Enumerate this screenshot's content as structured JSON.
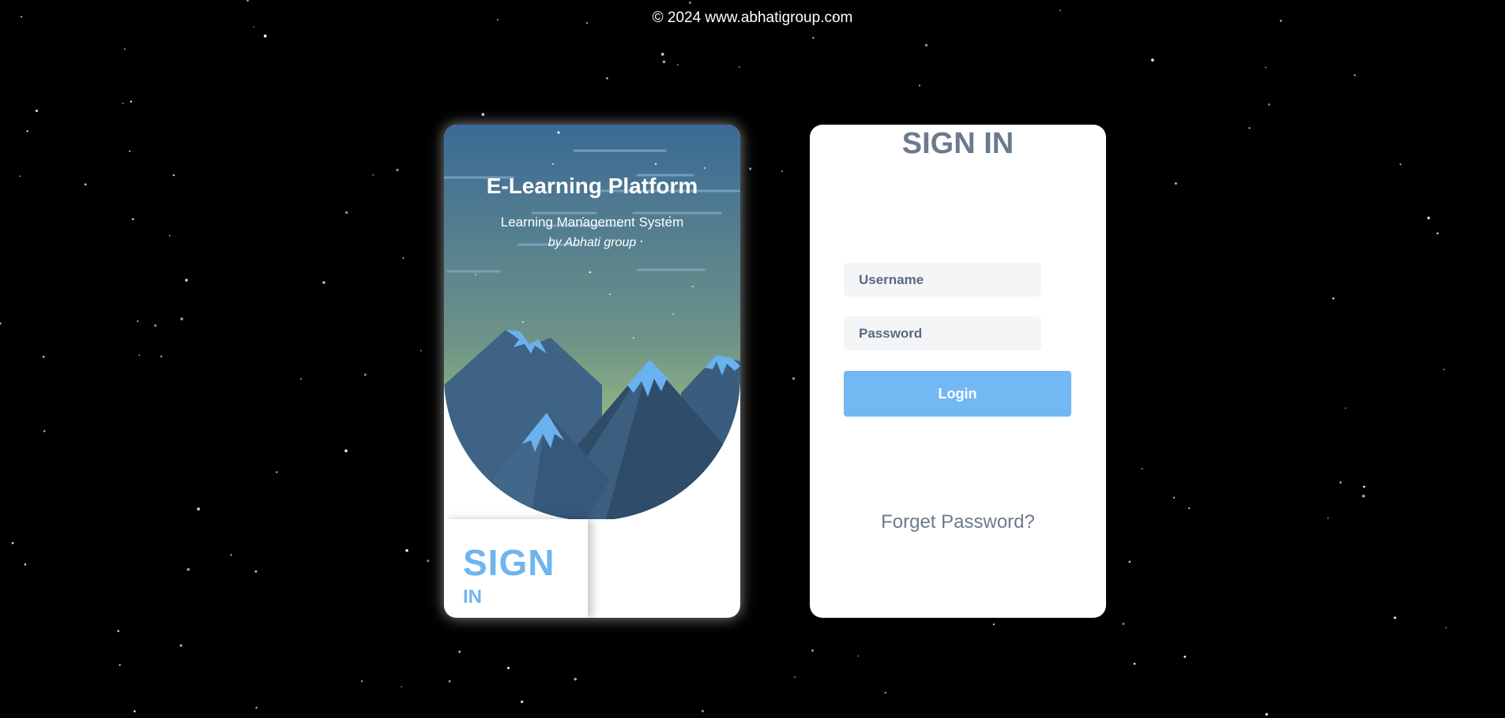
{
  "footer": {
    "copyright": "© 2024 www.abhatigroup.com"
  },
  "art_card": {
    "title": "E-Learning Platform",
    "subtitle": "Learning Management System",
    "byline": "by Abhati group",
    "fold_sign": "SIGN",
    "fold_in": "IN"
  },
  "form": {
    "title": "SIGN IN",
    "username_placeholder": "Username",
    "username_value": "",
    "password_placeholder": "Password",
    "password_value": "",
    "login_label": "Login",
    "forgot_label": "Forget Password?"
  },
  "colors": {
    "background": "#000000",
    "accent": "#72b8f3",
    "sign_text": "#6fb5ef",
    "muted_text": "#6c7a8d",
    "sky_top": "#3a6a96",
    "sky_bottom": "#9bbf82",
    "mountain_dark": "#2f4c68",
    "mountain_light": "#3f6384",
    "snow": "#6ab2ef"
  },
  "icons": {
    "mountain_illustration": "mountain-landscape-icon"
  }
}
